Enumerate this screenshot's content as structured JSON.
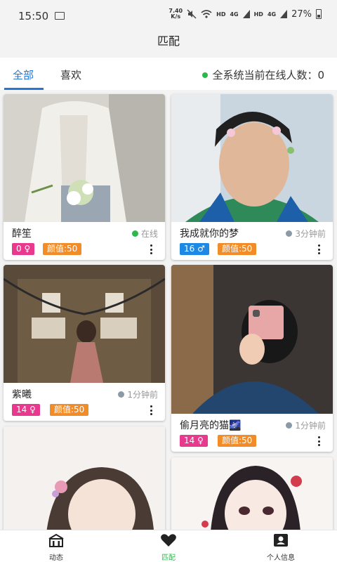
{
  "status_bar": {
    "time": "15:50",
    "speed_top": "7.40",
    "speed_bottom": "K/s",
    "hd1": "HD",
    "net1": "4G",
    "hd2": "HD",
    "net2": "4G",
    "battery": "27%"
  },
  "header": {
    "title": "匹配"
  },
  "tabs": [
    {
      "label": "全部",
      "active": true
    },
    {
      "label": "喜欢",
      "active": false
    }
  ],
  "online": {
    "text": "全系统当前在线人数：0",
    "dot_color": "#2db84d"
  },
  "cards": [
    {
      "name": "醉笙",
      "status": "在线",
      "status_color": "#2db84d",
      "age_badge": "0 ♀",
      "age_color": "#e8398e",
      "score": "颜值:50"
    },
    {
      "name": "我成就你的梦",
      "status": "3分钟前",
      "status_color": "#8a9aa6",
      "age_badge": "16 ♂",
      "age_color": "#1e88e5",
      "score": "颜值:50"
    },
    {
      "name": "紫曦",
      "status": "1分钟前",
      "status_color": "#8a9aa6",
      "age_badge": "14 ♀",
      "age_color": "#e8398e",
      "score": "颜值:50"
    },
    {
      "name": "偷月亮的猫🌌",
      "status": "1分钟前",
      "status_color": "#8a9aa6",
      "age_badge": "14 ♀",
      "age_color": "#e8398e",
      "score": "颜值:50"
    }
  ],
  "bottom_nav": [
    {
      "label": "动态",
      "icon": "home-icon"
    },
    {
      "label": "匹配",
      "icon": "heart-icon",
      "active": true,
      "active_color": "#2db84d"
    },
    {
      "label": "个人信息",
      "icon": "profile-card-icon"
    }
  ]
}
